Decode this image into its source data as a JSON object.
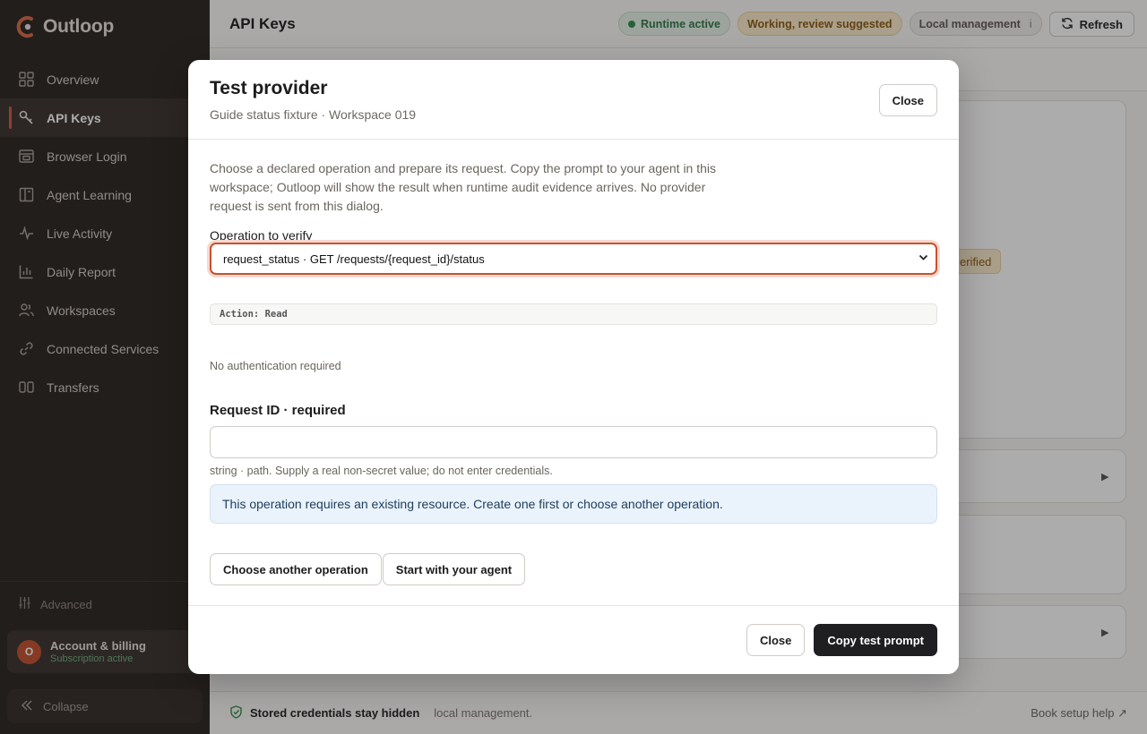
{
  "brand": {
    "name": "Outloop"
  },
  "sidebar": {
    "items": [
      {
        "label": "Overview",
        "icon": "grid-icon",
        "active": false
      },
      {
        "label": "API Keys",
        "icon": "key-icon",
        "active": true
      },
      {
        "label": "Browser Login",
        "icon": "browser-icon",
        "active": false
      },
      {
        "label": "Agent Learning",
        "icon": "book-icon",
        "active": false
      },
      {
        "label": "Live Activity",
        "icon": "pulse-icon",
        "active": false
      },
      {
        "label": "Daily Report",
        "icon": "bar-chart-icon",
        "active": false
      },
      {
        "label": "Workspaces",
        "icon": "users-icon",
        "active": false
      },
      {
        "label": "Connected Services",
        "icon": "link-icon",
        "active": false
      },
      {
        "label": "Transfers",
        "icon": "columns-icon",
        "active": false
      }
    ],
    "advanced_label": "Advanced",
    "account": {
      "initial": "O",
      "title": "Account & billing",
      "subtitle": "Subscription active"
    },
    "collapse_label": "Collapse"
  },
  "header": {
    "title": "API Keys",
    "runtime_badge": "Runtime active",
    "working_badge": "Working, review suggested",
    "local_badge": "Local management",
    "local_info": "i",
    "refresh_label": "Refresh"
  },
  "background": {
    "verified_chip": "erified",
    "row_arrow": "▶"
  },
  "footer": {
    "strong": "Stored credentials stay hidden",
    "muted": "local management.",
    "link": "Book setup help ↗"
  },
  "modal": {
    "title": "Test provider",
    "subtitle": "Guide status fixture · Workspace 019",
    "close_label": "Close",
    "intro": "Choose a declared operation and prepare its request. Copy the prompt to your agent in this workspace; Outloop will show the result when runtime audit evidence arrives. No provider request is sent from this dialog.",
    "operation_label": "Operation to verify",
    "operation_selected": "request_status · GET /requests/{request_id}/status",
    "action_chip": "Action: Read",
    "auth_note": "No authentication required",
    "request_label": "Request ID · required",
    "request_value": "",
    "request_hint": "string · path. Supply a real non-secret value; do not enter credentials.",
    "info": "This operation requires an existing resource. Create one first or choose another operation.",
    "choose_another": "Choose another operation",
    "start_agent": "Start with your agent",
    "footer_close": "Close",
    "copy_prompt": "Copy test prompt"
  },
  "colors": {
    "accent": "#c7512f",
    "sidebar_bg": "#2a2523",
    "primary_button": "#1f1f22",
    "info_bg": "#eaf3fc"
  }
}
